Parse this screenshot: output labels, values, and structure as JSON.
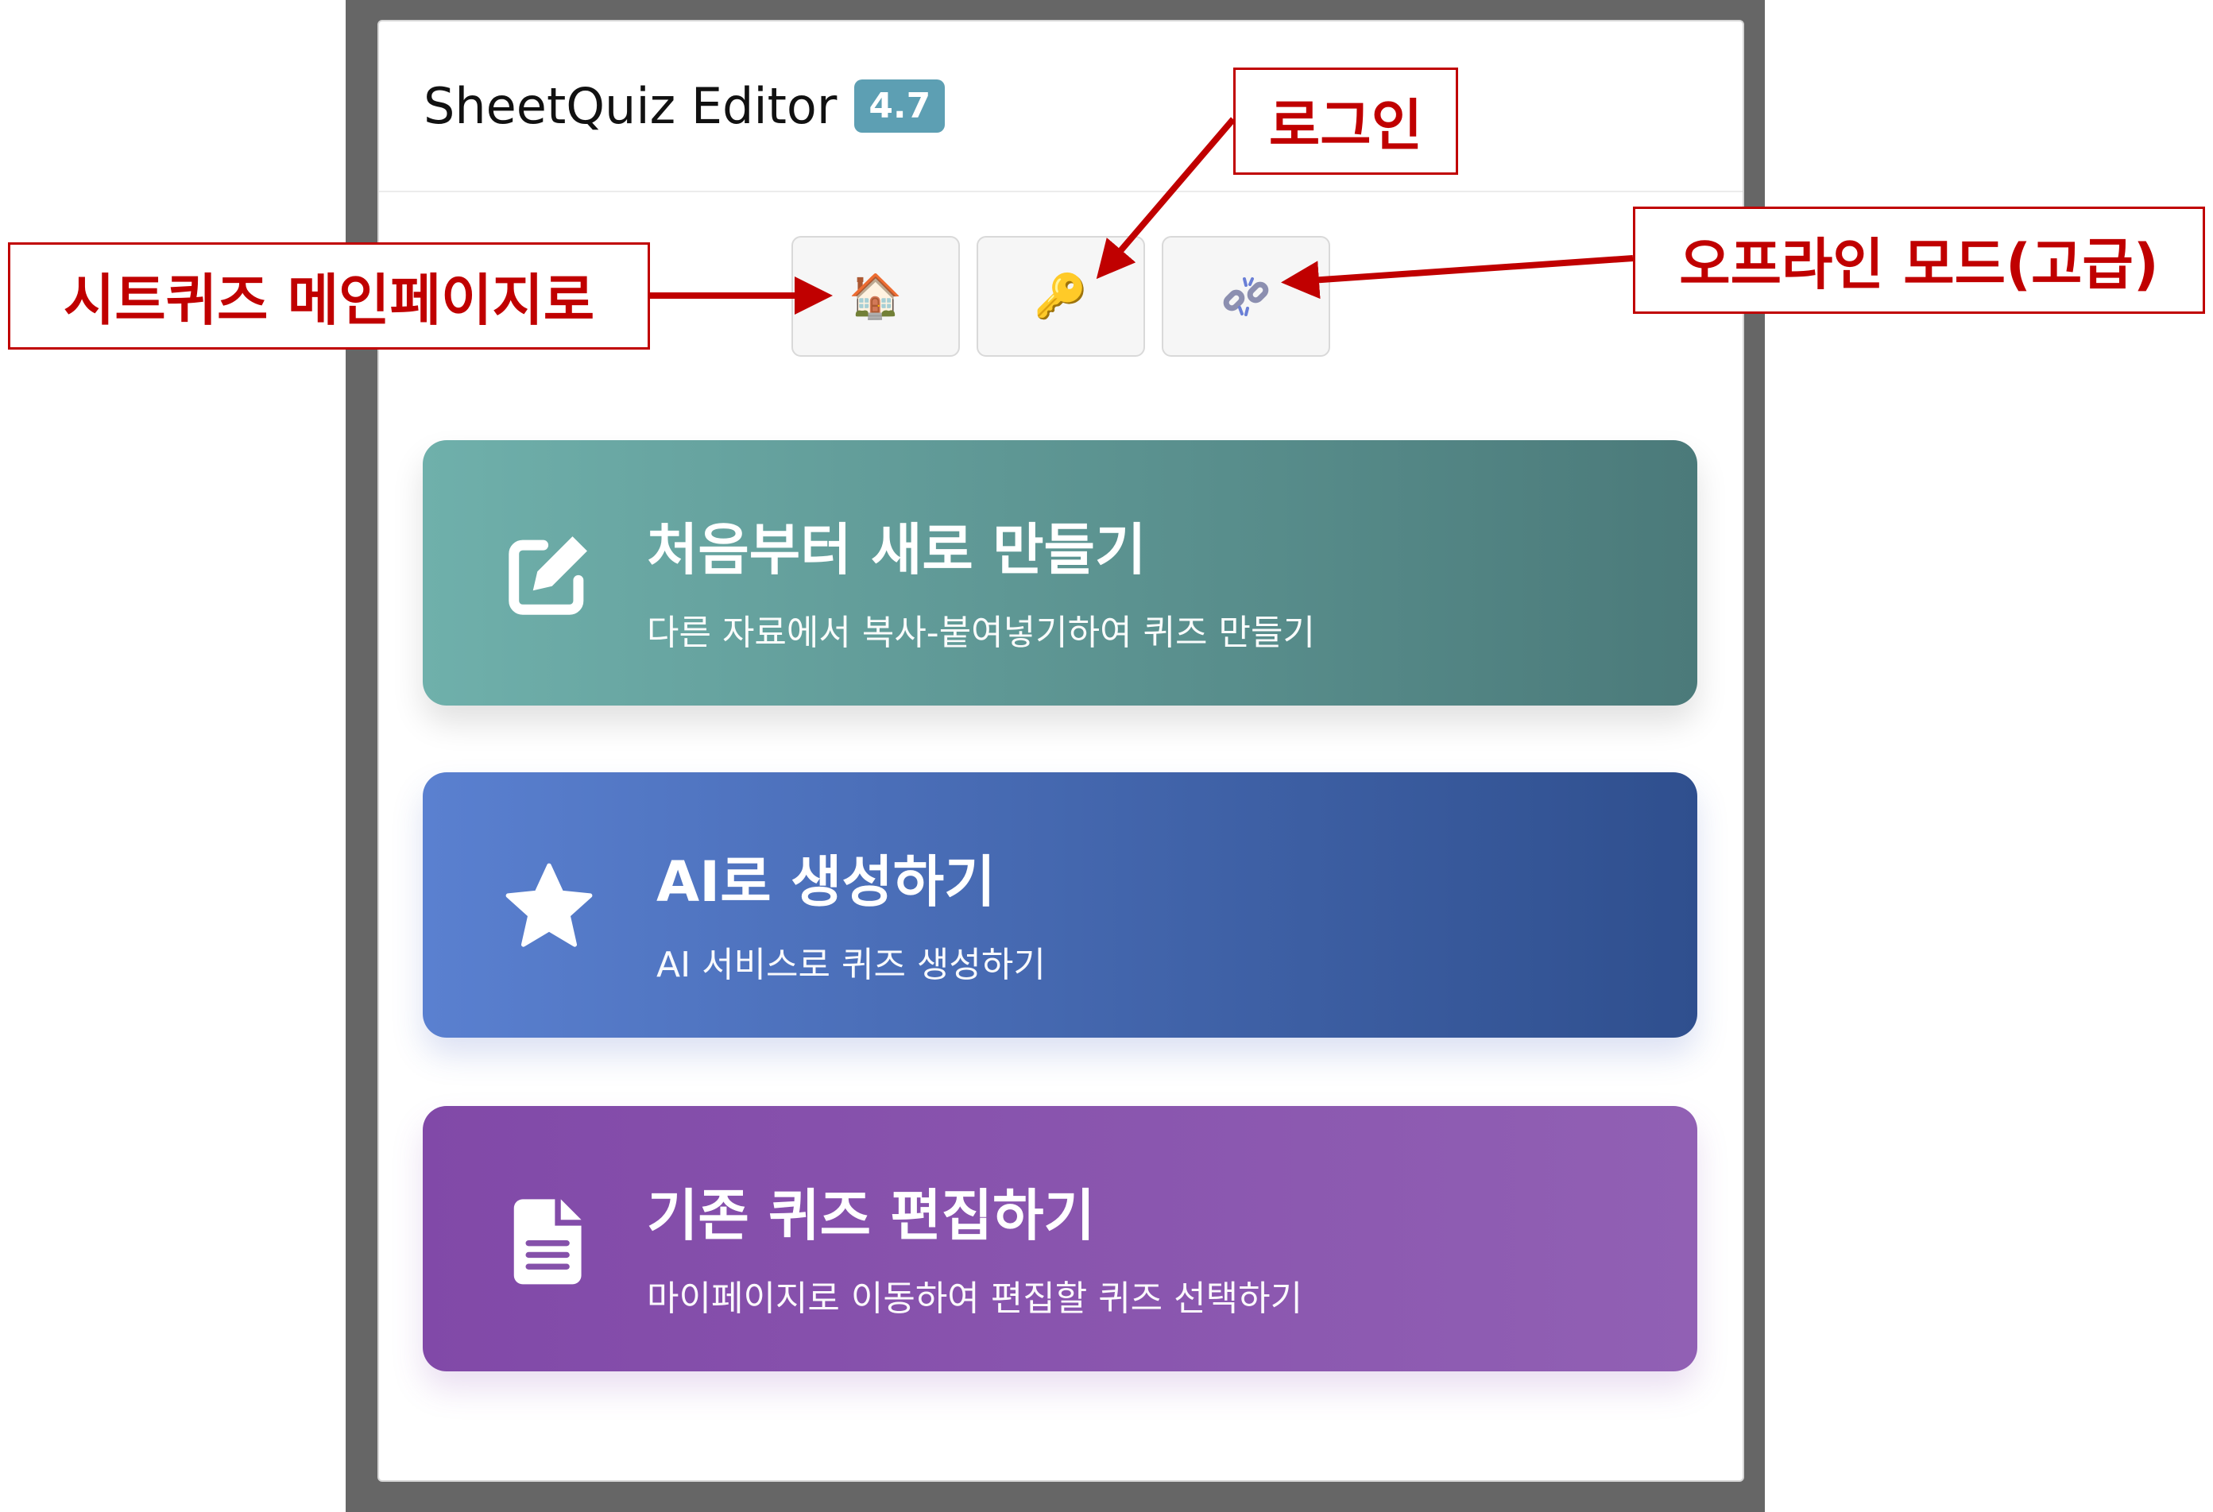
{
  "header": {
    "title": "SheetQuiz Editor",
    "version": "4.7"
  },
  "toolbar": {
    "home": {
      "icon": "house-icon",
      "glyph": "🏠"
    },
    "login": {
      "icon": "key-icon",
      "glyph": "🔑"
    },
    "offline": {
      "icon": "broken-chain-icon"
    }
  },
  "cards": [
    {
      "title": "처음부터 새로 만들기",
      "subtitle": "다른 자료에서 복사-붙여넣기하여 퀴즈 만들기",
      "icon": "edit-icon"
    },
    {
      "title": "AI로 생성하기",
      "subtitle": "AI 서비스로 퀴즈 생성하기",
      "icon": "star-icon"
    },
    {
      "title": "기존 퀴즈 편집하기",
      "subtitle": "마이페이지로 이동하여 편집할 퀴즈 선택하기",
      "icon": "document-icon"
    }
  ],
  "annotations": {
    "home": "시트퀴즈 메인페이지로",
    "login": "로그인",
    "offline": "오프라인 모드(고급)"
  },
  "colors": {
    "accent_red": "#c00000",
    "badge": "#5d9fb3",
    "create": [
      "#6fb0ab",
      "#4b7a7a"
    ],
    "ai": [
      "#5a80d0",
      "#2f4f8e"
    ],
    "edit": [
      "#8149a8",
      "#9160b4"
    ]
  }
}
